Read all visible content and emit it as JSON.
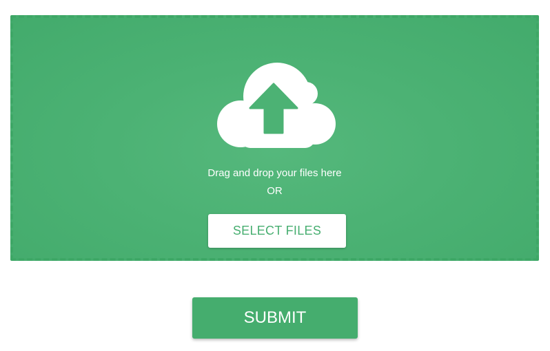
{
  "upload": {
    "drag_text": "Drag and drop your files here",
    "or_text": "OR",
    "select_label": "SELECT FILES",
    "icon": "cloud-upload-icon"
  },
  "form": {
    "submit_label": "SUBMIT"
  },
  "colors": {
    "accent": "#4cb274",
    "dropzone_border": "#3ea766",
    "button_text": "#47ae70",
    "white": "#ffffff"
  }
}
